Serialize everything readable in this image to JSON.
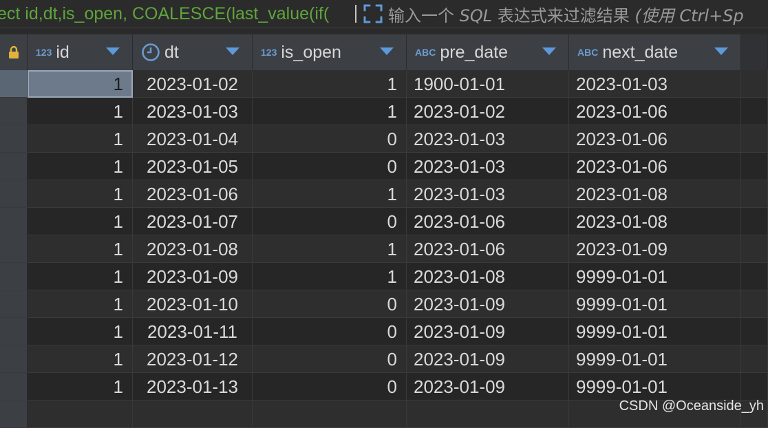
{
  "filter": {
    "sql_text": "ect id,dt,is_open, COALESCE(last_value(if(",
    "placeholder_main": "输入一个 ",
    "placeholder_sql": "SQL",
    "placeholder_rest": " 表达式来过滤结果 ",
    "placeholder_hint": "(使用 Ctrl+Sp"
  },
  "columns": [
    {
      "type_badge": "123",
      "label": "id"
    },
    {
      "type_badge": "clock",
      "label": "dt"
    },
    {
      "type_badge": "123",
      "label": "is_open"
    },
    {
      "type_badge": "ABC",
      "label": "pre_date"
    },
    {
      "type_badge": "ABC",
      "label": "next_date"
    }
  ],
  "rows": [
    [
      "1",
      "2023-01-02",
      "1",
      "1900-01-01",
      "2023-01-03"
    ],
    [
      "1",
      "2023-01-03",
      "1",
      "2023-01-02",
      "2023-01-06"
    ],
    [
      "1",
      "2023-01-04",
      "0",
      "2023-01-03",
      "2023-01-06"
    ],
    [
      "1",
      "2023-01-05",
      "0",
      "2023-01-03",
      "2023-01-06"
    ],
    [
      "1",
      "2023-01-06",
      "1",
      "2023-01-03",
      "2023-01-08"
    ],
    [
      "1",
      "2023-01-07",
      "0",
      "2023-01-06",
      "2023-01-08"
    ],
    [
      "1",
      "2023-01-08",
      "1",
      "2023-01-06",
      "2023-01-09"
    ],
    [
      "1",
      "2023-01-09",
      "1",
      "2023-01-08",
      "9999-01-01"
    ],
    [
      "1",
      "2023-01-10",
      "0",
      "2023-01-09",
      "9999-01-01"
    ],
    [
      "1",
      "2023-01-11",
      "0",
      "2023-01-09",
      "9999-01-01"
    ],
    [
      "1",
      "2023-01-12",
      "0",
      "2023-01-09",
      "9999-01-01"
    ],
    [
      "1",
      "2023-01-13",
      "0",
      "2023-01-09",
      "9999-01-01"
    ]
  ],
  "watermark": "CSDN @Oceanside_yh",
  "colors": {
    "sql_green": "#5fa53c",
    "type_blue": "#6d9bd1",
    "lock_gold": "#e2b33a"
  }
}
